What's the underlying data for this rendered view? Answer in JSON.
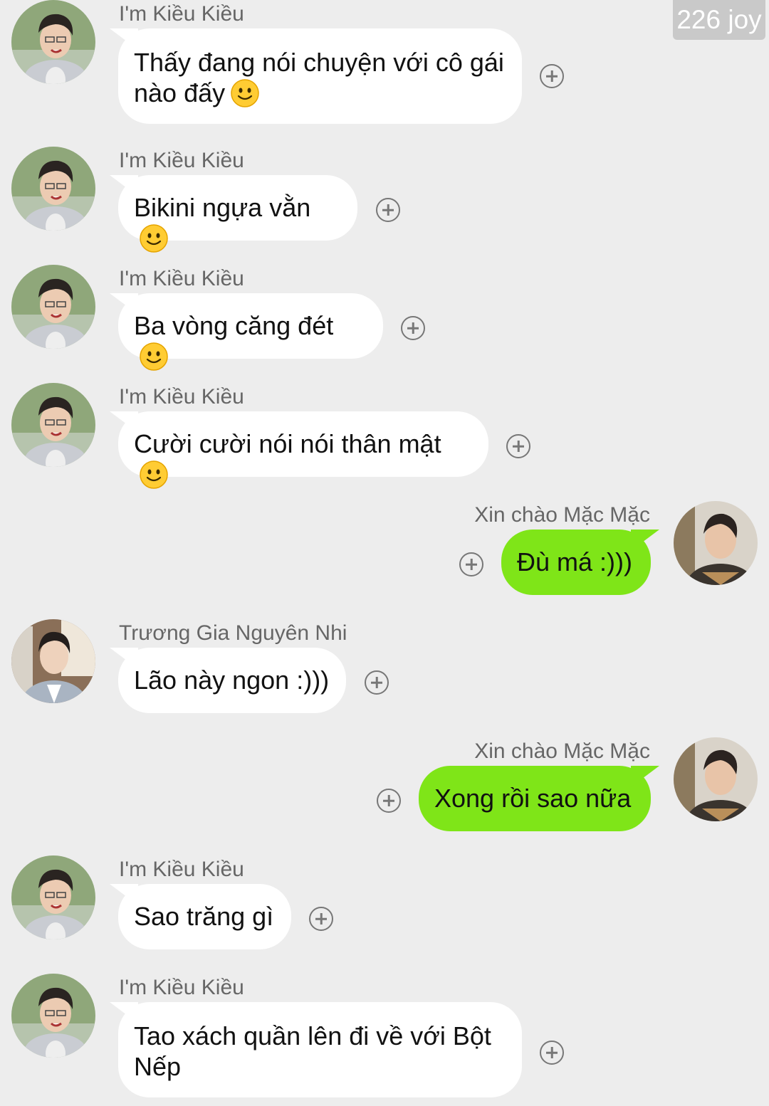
{
  "watermark": "226 joy",
  "colors": {
    "background": "#ededed",
    "incoming_bubble": "#ffffff",
    "outgoing_bubble": "#7fe518"
  },
  "messages": [
    {
      "sender": "I'm Kiều Kiều",
      "text": "Thấy đang nói chuyện với cô gái",
      "text2": "nào đấy",
      "emoji": "slightly-smiling-face",
      "direction": "incoming"
    },
    {
      "sender": "I'm Kiều Kiều",
      "text": "Bikini ngựa vằn",
      "emoji": "slightly-smiling-face",
      "direction": "incoming"
    },
    {
      "sender": "I'm Kiều Kiều",
      "text": "Ba vòng căng đét",
      "emoji": "slightly-smiling-face",
      "direction": "incoming"
    },
    {
      "sender": "I'm Kiều Kiều",
      "text": "Cười cười nói nói thân mật",
      "emoji": "slightly-smiling-face",
      "direction": "incoming"
    },
    {
      "sender": "Xin chào Mặc Mặc",
      "text": "Đù má :)))",
      "direction": "outgoing"
    },
    {
      "sender": "Trương Gia Nguyên Nhi",
      "text": "Lão này ngon :)))",
      "direction": "incoming"
    },
    {
      "sender": "Xin chào Mặc Mặc",
      "text": "Xong rồi sao nữa",
      "direction": "outgoing"
    },
    {
      "sender": "I'm Kiều Kiều",
      "text": "Sao trăng gì",
      "direction": "incoming"
    },
    {
      "sender": "I'm Kiều Kiều",
      "text": "Tao xách quần lên đi về với Bột",
      "text2": "Nếp",
      "direction": "incoming"
    }
  ]
}
